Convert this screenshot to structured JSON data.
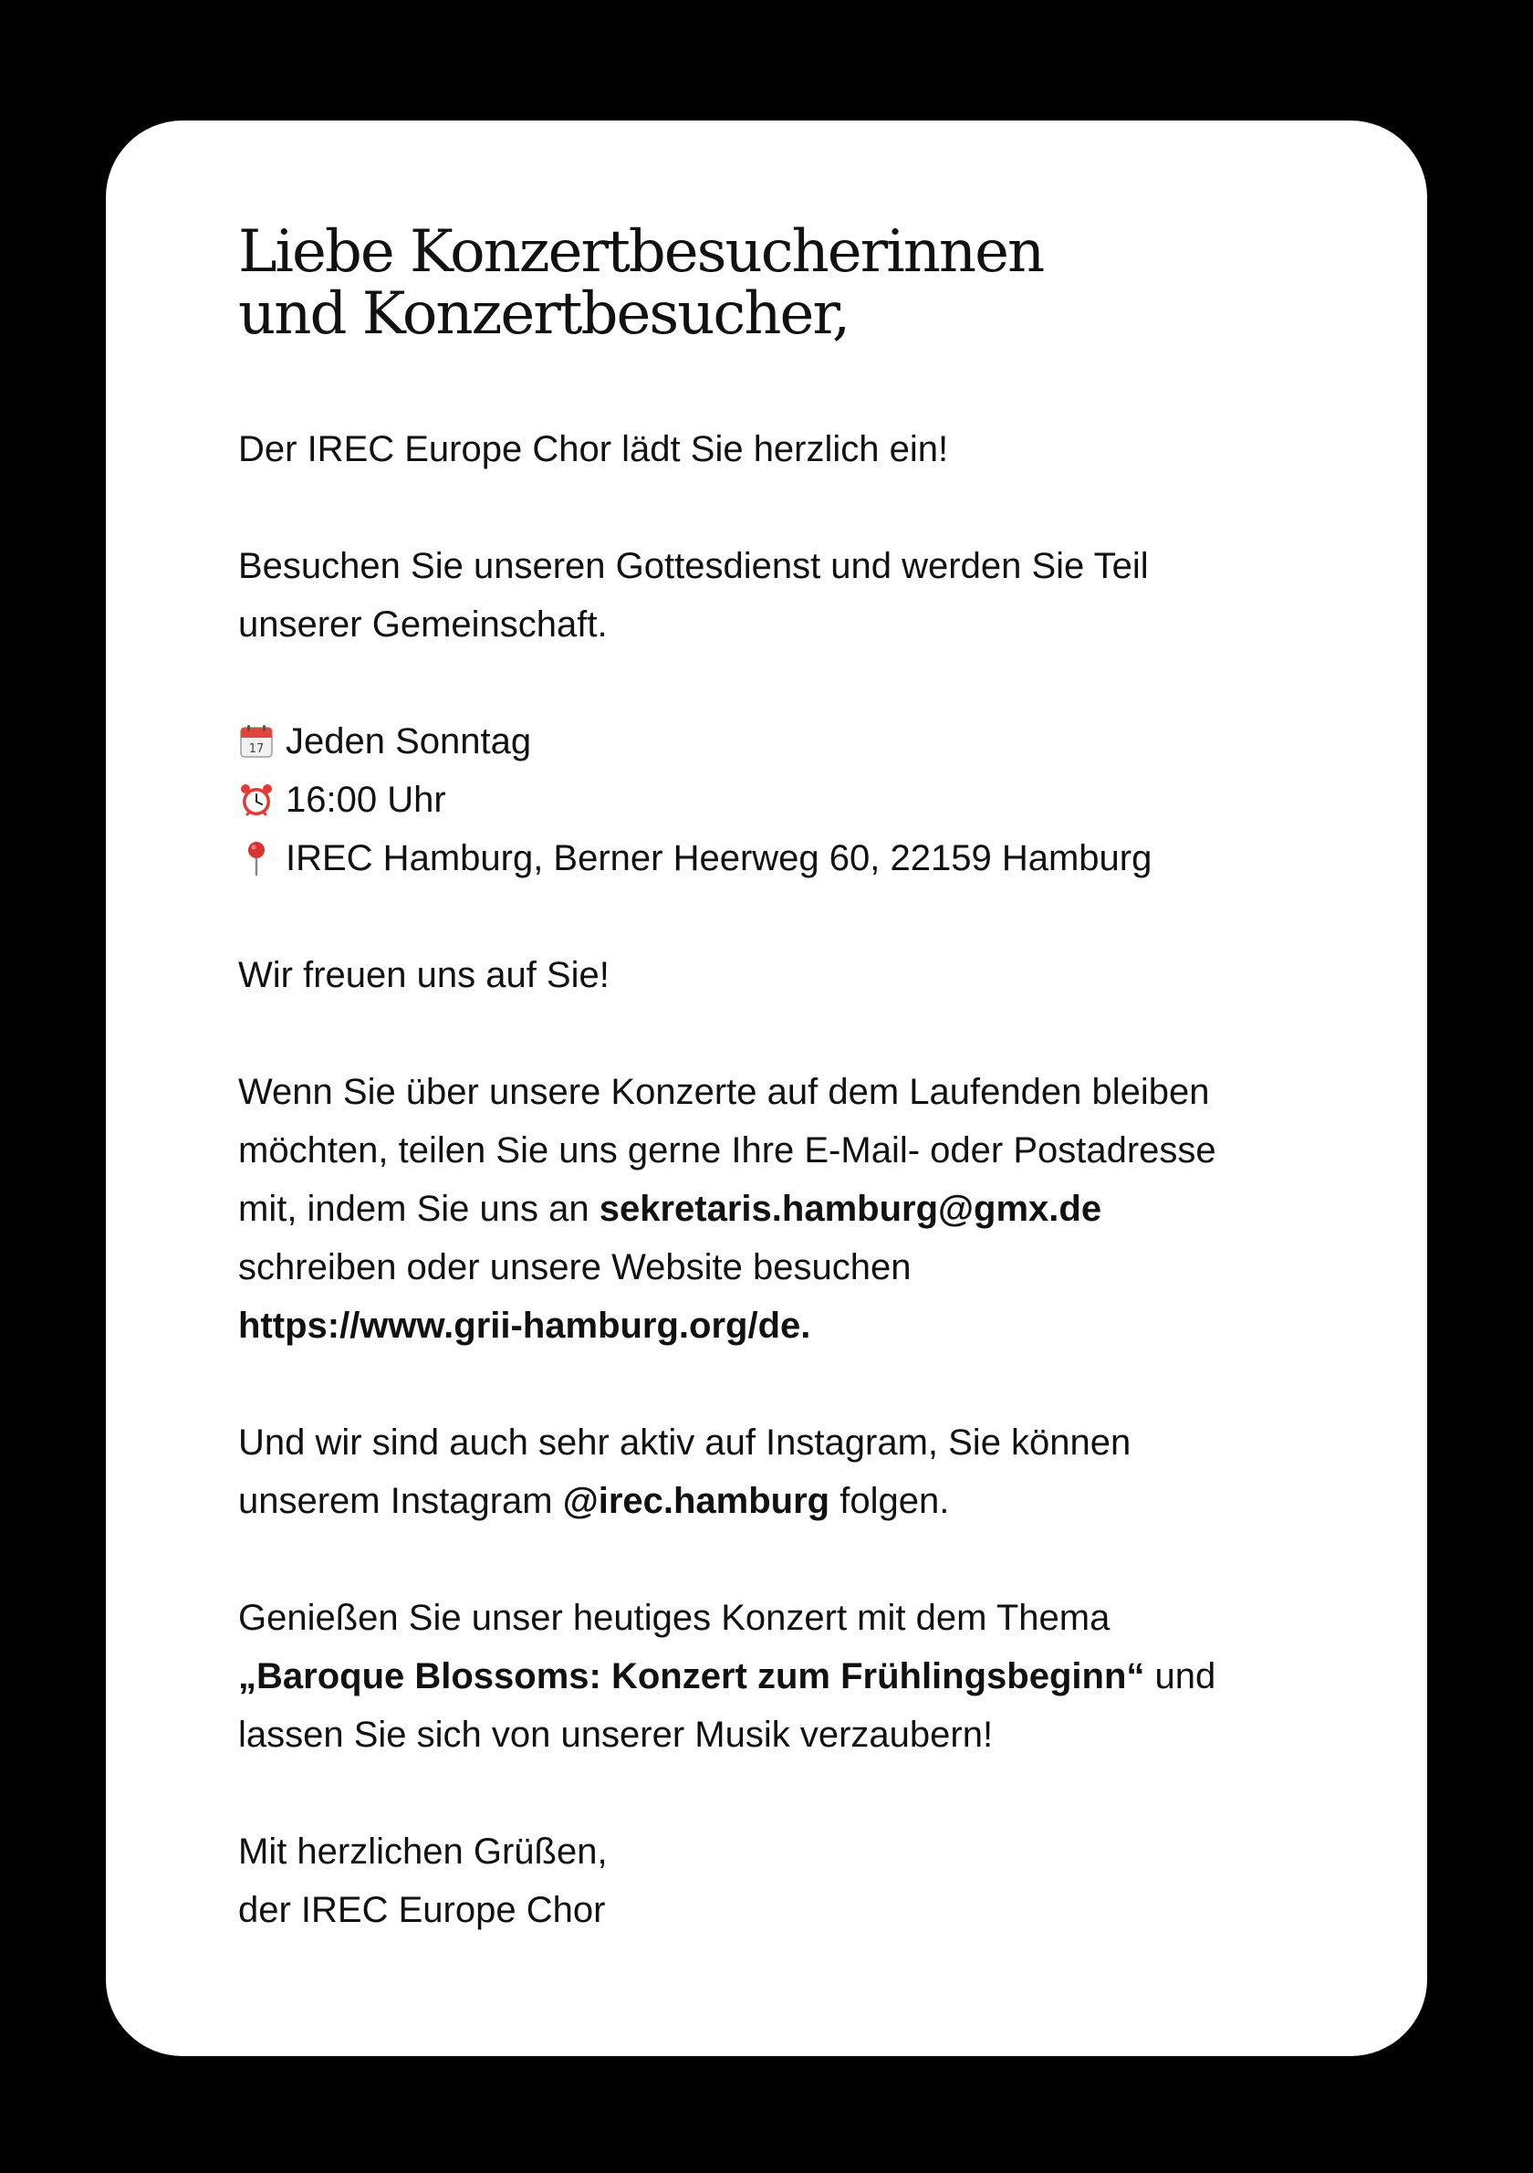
{
  "heading": {
    "line1": "Liebe Konzertbesucherinnen",
    "line2": "und Konzertbesucher,"
  },
  "invite": "Der IREC Europe Chor lädt Sie herzlich ein!",
  "service": {
    "line1": "Besuchen Sie unseren Gottesdienst und werden Sie Teil",
    "line2": "unserer Gemeinschaft."
  },
  "details": [
    {
      "icon": "calendar-icon",
      "text": "Jeden Sonntag"
    },
    {
      "icon": "alarm-clock-icon",
      "text": "16:00 Uhr"
    },
    {
      "icon": "pin-icon",
      "text": "IREC Hamburg, Berner Heerweg 60, 22159 Hamburg"
    }
  ],
  "welcome": "Wir freuen uns auf Sie!",
  "contact": {
    "line1": "Wenn Sie über unsere Konzerte auf dem Laufenden bleiben",
    "line2": "möchten, teilen Sie uns gerne Ihre E-Mail- oder Postadresse",
    "line3_prefix": "mit, indem Sie uns an ",
    "email": "sekretaris.hamburg@gmx.de",
    "line4": "schreiben oder unsere Website besuchen",
    "website": "https://www.grii-hamburg.org/de."
  },
  "instagram": {
    "line1": "Und wir sind auch sehr aktiv auf Instagram, Sie können",
    "line2_prefix": "unserem Instagram ",
    "handle": "@irec.hamburg",
    "line2_suffix": " folgen."
  },
  "concert": {
    "line1": "Genießen Sie unser heutiges Konzert mit dem Thema",
    "title": "„Baroque Blossoms: Konzert zum Frühlingsbeginn“",
    "line2_suffix": " und",
    "line3": "lassen Sie sich von unserer Musik verzaubern!"
  },
  "closing": {
    "line1": "Mit herzlichen Grüßen,",
    "line2": "der IREC Europe Chor"
  },
  "colors": {
    "background": "#000000",
    "card": "#ffffff",
    "text": "#111111",
    "calendar_red": "#e0443a",
    "clock_red": "#e53935",
    "pin_red": "#d8332f"
  }
}
